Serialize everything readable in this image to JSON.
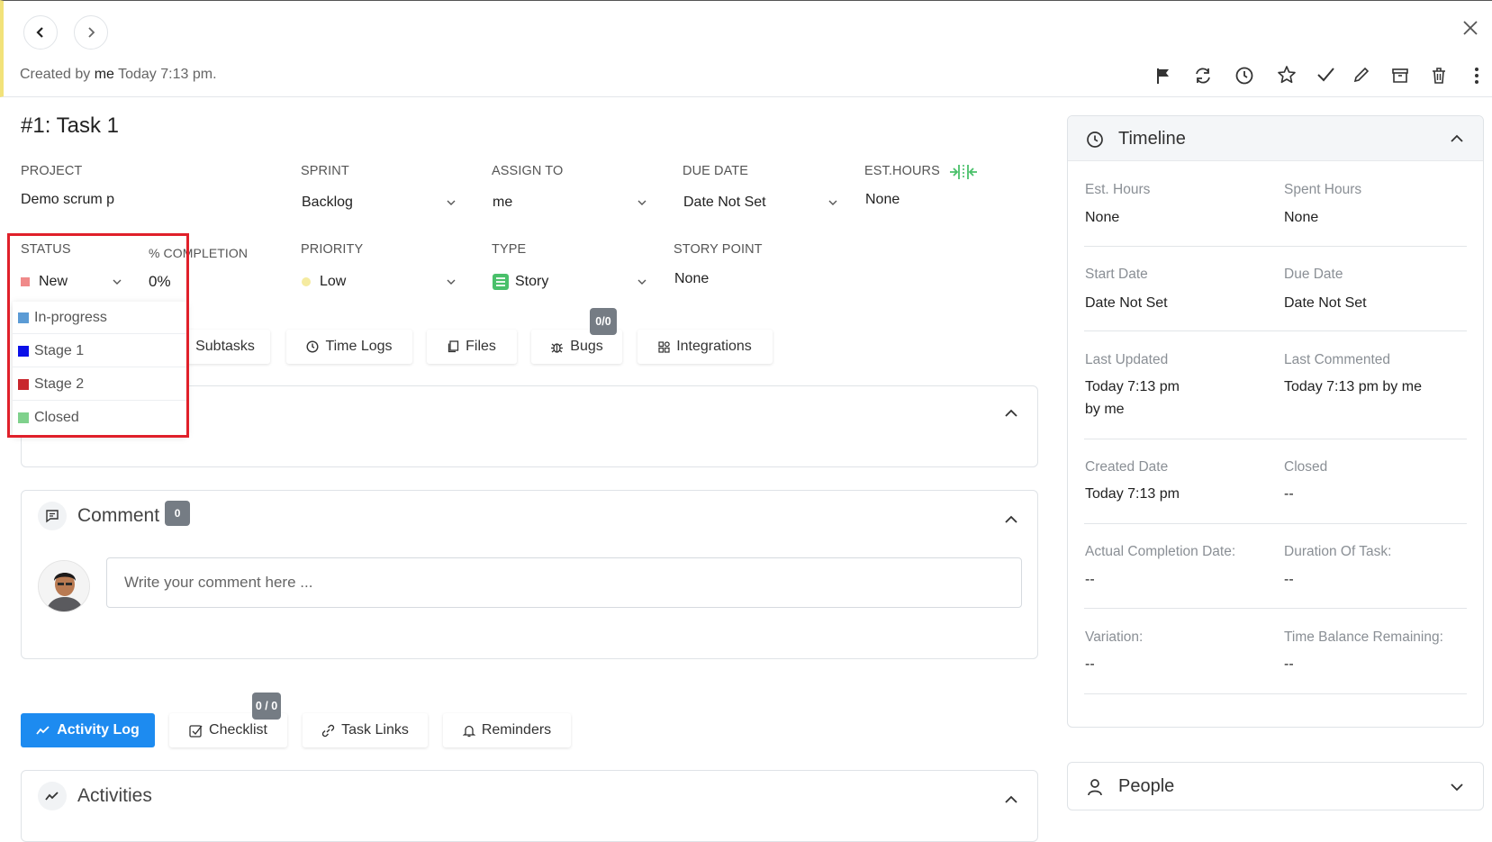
{
  "header": {
    "created_prefix": "Created by",
    "created_user": "me",
    "created_time": "Today 7:13 pm."
  },
  "task": {
    "title": "#1: Task 1"
  },
  "fields": {
    "project_label": "PROJECT",
    "project_value": "Demo scrum p",
    "sprint_label": "SPRINT",
    "sprint_value": "Backlog",
    "assign_label": "ASSIGN TO",
    "assign_value": "me",
    "due_label": "DUE DATE",
    "due_value": "Date Not Set",
    "est_label": "EST.HOURS",
    "est_value": "None",
    "status_label": "STATUS",
    "status_value": "New",
    "completion_label": "% COMPLETION",
    "completion_value": "0%",
    "priority_label": "PRIORITY",
    "priority_value": "Low",
    "type_label": "TYPE",
    "type_value": "Story",
    "storypoint_label": "STORY POINT",
    "storypoint_value": "None"
  },
  "status_options": [
    {
      "label": "In-progress",
      "color": "#5b9bd5"
    },
    {
      "label": "Stage 1",
      "color": "#0a10e8"
    },
    {
      "label": "Stage 2",
      "color": "#c8262c"
    },
    {
      "label": "Closed",
      "color": "#7fd18c"
    }
  ],
  "colors": {
    "status_new": "#f08a8a",
    "priority_low": "#f5eba0",
    "type_story": "#49c06a",
    "primary": "#1d8bf0",
    "highlight": "#e0202a"
  },
  "tabs": {
    "subtasks": "Subtasks",
    "timelogs": "Time Logs",
    "files": "Files",
    "bugs": "Bugs",
    "bugs_badge": "0/0",
    "integrations": "Integrations"
  },
  "comment": {
    "title": "Comment",
    "count": "0",
    "placeholder": "Write your comment here ..."
  },
  "bottom_tabs": {
    "activity": "Activity Log",
    "checklist": "Checklist",
    "checklist_badge": "0 / 0",
    "tasklinks": "Task Links",
    "reminders": "Reminders"
  },
  "activities": {
    "title": "Activities"
  },
  "timeline": {
    "title": "Timeline",
    "est_hours_k": "Est. Hours",
    "est_hours_v": "None",
    "spent_hours_k": "Spent Hours",
    "spent_hours_v": "None",
    "start_date_k": "Start Date",
    "start_date_v": "Date Not Set",
    "due_date_k": "Due Date",
    "due_date_v": "Date Not Set",
    "last_updated_k": "Last Updated",
    "last_updated_v1": "Today 7:13 pm",
    "last_updated_v2": "by me",
    "last_commented_k": "Last Commented",
    "last_commented_v": "Today 7:13 pm by me",
    "created_date_k": "Created Date",
    "created_date_v": "Today 7:13 pm",
    "closed_k": "Closed",
    "closed_v": "--",
    "actual_completion_k": "Actual Completion Date:",
    "actual_completion_v": "--",
    "duration_k": "Duration Of Task:",
    "duration_v": "--",
    "variation_k": "Variation:",
    "variation_v": "--",
    "balance_k": "Time Balance Remaining:",
    "balance_v": "--"
  },
  "people": {
    "title": "People"
  }
}
